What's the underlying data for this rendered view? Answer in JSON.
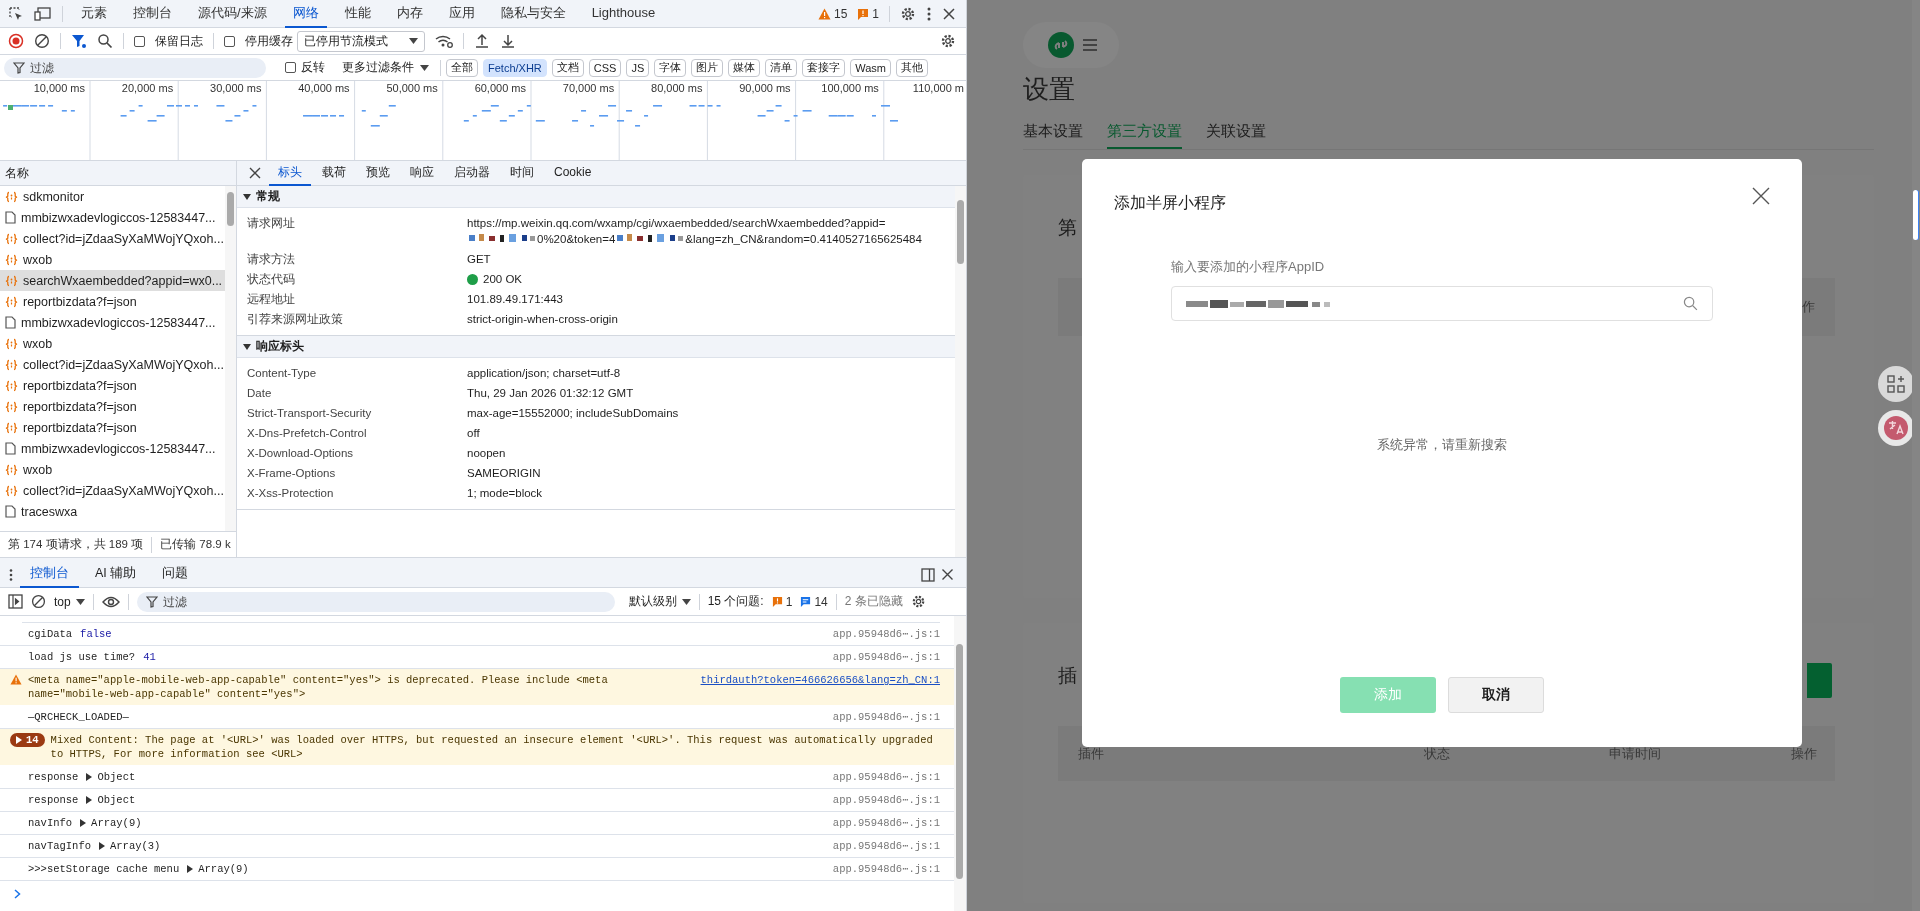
{
  "devtools": {
    "tabs": [
      {
        "label": "元素",
        "selected": false
      },
      {
        "label": "控制台",
        "selected": false
      },
      {
        "label": "源代码/来源",
        "selected": false
      },
      {
        "label": "网络",
        "selected": true
      },
      {
        "label": "性能",
        "selected": false
      },
      {
        "label": "内存",
        "selected": false
      },
      {
        "label": "应用",
        "selected": false
      },
      {
        "label": "隐私与安全",
        "selected": false
      },
      {
        "label": "Lighthouse",
        "selected": false
      }
    ],
    "warning_count": "15",
    "error_count": "1",
    "network_toolbar": {
      "preserve_log": {
        "label": "保留日志",
        "checked": false
      },
      "disable_cache": {
        "label": "停用缓存",
        "checked": false
      },
      "throttling": "已停用节流模式"
    },
    "filter_bar": {
      "placeholder": "过滤",
      "invert": {
        "label": "反转",
        "checked": false
      },
      "more_filters": "更多过滤条件",
      "types": [
        {
          "label": "全部",
          "selected": false
        },
        {
          "label": "Fetch/XHR",
          "selected": true
        },
        {
          "label": "文档",
          "selected": false
        },
        {
          "label": "CSS",
          "selected": false
        },
        {
          "label": "JS",
          "selected": false
        },
        {
          "label": "字体",
          "selected": false
        },
        {
          "label": "图片",
          "selected": false
        },
        {
          "label": "媒体",
          "selected": false
        },
        {
          "label": "清单",
          "selected": false
        },
        {
          "label": "套接字",
          "selected": false
        },
        {
          "label": "Wasm",
          "selected": false
        },
        {
          "label": "其他",
          "selected": false
        }
      ]
    },
    "timeline": {
      "ticks": [
        "10,000 ms",
        "20,000 ms",
        "30,000 ms",
        "40,000 ms",
        "50,000 ms",
        "60,000 ms",
        "70,000 ms",
        "80,000 ms",
        "90,000 ms",
        "100,000 ms",
        "110,000 m"
      ]
    },
    "requests": {
      "header": "名称",
      "rows": [
        {
          "name": "sdkmonitor",
          "kind": "xhr",
          "selected": false
        },
        {
          "name": "mmbizwxadevlogiccos-12583447...",
          "kind": "doc",
          "selected": false
        },
        {
          "name": "collect?id=jZdaaSyXaMWojYQxoh...",
          "kind": "xhr",
          "selected": false
        },
        {
          "name": "wxob",
          "kind": "xhr",
          "selected": false
        },
        {
          "name": "searchWxaembedded?appid=wx0...",
          "kind": "xhr",
          "selected": true
        },
        {
          "name": "reportbizdata?f=json",
          "kind": "xhr",
          "selected": false
        },
        {
          "name": "mmbizwxadevlogiccos-12583447...",
          "kind": "doc",
          "selected": false
        },
        {
          "name": "wxob",
          "kind": "xhr",
          "selected": false
        },
        {
          "name": "collect?id=jZdaaSyXaMWojYQxoh...",
          "kind": "xhr",
          "selected": false
        },
        {
          "name": "reportbizdata?f=json",
          "kind": "xhr",
          "selected": false
        },
        {
          "name": "reportbizdata?f=json",
          "kind": "xhr",
          "selected": false
        },
        {
          "name": "reportbizdata?f=json",
          "kind": "xhr",
          "selected": false
        },
        {
          "name": "mmbizwxadevlogiccos-12583447...",
          "kind": "doc",
          "selected": false
        },
        {
          "name": "wxob",
          "kind": "xhr",
          "selected": false
        },
        {
          "name": "collect?id=jZdaaSyXaMWojYQxoh...",
          "kind": "xhr",
          "selected": false
        },
        {
          "name": "traceswxa",
          "kind": "doc",
          "selected": false
        }
      ]
    },
    "status_bar": [
      "第 174 项请求，共 189 项",
      "已传输 78.9 k"
    ],
    "details": {
      "tabs": [
        {
          "label": "标头",
          "selected": true
        },
        {
          "label": "载荷",
          "selected": false
        },
        {
          "label": "预览",
          "selected": false
        },
        {
          "label": "响应",
          "selected": false
        },
        {
          "label": "启动器",
          "selected": false
        },
        {
          "label": "时间",
          "selected": false
        },
        {
          "label": "Cookie",
          "selected": false
        }
      ],
      "sections": [
        {
          "title": "常规",
          "expanded": true,
          "rows": [
            {
              "key": "请求网址",
              "kind": "url",
              "parts": [
                {
                  "kind": "text",
                  "text": "https://mp.weixin.qq.com/wxamp/cgi/wxaembedded/searchWxaembedded?appid"
                },
                {
                  "kind": "text",
                  "text": "="
                },
                {
                  "kind": "redacted"
                },
                {
                  "kind": "text",
                  "text": "0%20&token=4"
                },
                {
                  "kind": "redacted"
                },
                {
                  "kind": "text",
                  "text": "&lang=zh_CN&random=0.4140527165625484"
                }
              ]
            },
            {
              "key": "请求方法",
              "kind": "text",
              "value": "GET"
            },
            {
              "key": "状态代码",
              "kind": "status",
              "value": "200 OK",
              "color": "#1e9e48"
            },
            {
              "key": "远程地址",
              "kind": "text",
              "value": "101.89.49.171:443"
            },
            {
              "key": "引荐来源网址政策",
              "kind": "text",
              "value": "strict-origin-when-cross-origin"
            }
          ]
        },
        {
          "title": "响应标头",
          "expanded": true,
          "rows": [
            {
              "key": "Content-Type",
              "kind": "text",
              "value": "application/json; charset=utf-8"
            },
            {
              "key": "Date",
              "kind": "text",
              "value": "Thu, 29 Jan 2026 01:32:12 GMT"
            },
            {
              "key": "Strict-Transport-Security",
              "kind": "text",
              "value": "max-age=15552000; includeSubDomains"
            },
            {
              "key": "X-Dns-Prefetch-Control",
              "kind": "text",
              "value": "off"
            },
            {
              "key": "X-Download-Options",
              "kind": "text",
              "value": "noopen"
            },
            {
              "key": "X-Frame-Options",
              "kind": "text",
              "value": "SAMEORIGIN"
            },
            {
              "key": "X-Xss-Protection",
              "kind": "text",
              "value": "1; mode=block"
            }
          ]
        }
      ]
    },
    "console": {
      "tabs": [
        {
          "label": "控制台",
          "selected": true
        },
        {
          "label": "AI 辅助",
          "selected": false
        },
        {
          "label": "问题",
          "selected": false
        }
      ],
      "toolbar": {
        "context": "top",
        "placeholder": "过滤",
        "level": "默认级别",
        "issues_label": "15 个问题:",
        "issue_errors": "1",
        "issue_infos": "14",
        "hidden": "2 条已隐藏"
      },
      "messages": [
        {
          "kind": "log",
          "text": "cgiData",
          "value": "false",
          "expandable": false,
          "source": "app.95948d6⋯.js:1"
        },
        {
          "kind": "log",
          "text": "load js use time?",
          "value": "41",
          "expandable": false,
          "source": "app.95948d6⋯.js:1"
        },
        {
          "kind": "warning",
          "text": "<meta name=\"apple-mobile-web-app-capable\" content=\"yes\"> is deprecated. Please include <meta name=\"mobile-web-app-capable\" content=\"yes\">",
          "source": "thirdauth?token=466626656&lang=zh_CN:1"
        },
        {
          "kind": "log",
          "text": "—QRCHECK_LOADED—",
          "source": "app.95948d6⋯.js:1"
        },
        {
          "kind": "issue",
          "count": "14",
          "text": "Mixed Content: The page at '<URL>' was loaded over HTTPS, but requested an insecure element '<URL>'. This request was automatically upgraded to HTTPS, For more information see <URL>"
        },
        {
          "kind": "log",
          "text": "response",
          "value": "Object",
          "expandable": true,
          "source": "app.95948d6⋯.js:1"
        },
        {
          "kind": "log",
          "text": "response",
          "value": "Object",
          "expandable": true,
          "source": "app.95948d6⋯.js:1"
        },
        {
          "kind": "log",
          "text": "navInfo",
          "value": "Array(9)",
          "expandable": true,
          "source": "app.95948d6⋯.js:1"
        },
        {
          "kind": "log",
          "text": "navTagInfo",
          "value": "Array(3)",
          "expandable": true,
          "source": "app.95948d6⋯.js:1"
        },
        {
          "kind": "log",
          "text": ">>>setStorage cache menu",
          "value": "Array(9)",
          "expandable": true,
          "source": "app.95948d6⋯.js:1"
        }
      ]
    }
  },
  "page": {
    "title": "设置",
    "tabs": [
      {
        "label": "基本设置",
        "selected": false
      },
      {
        "label": "第三方设置",
        "selected": true
      },
      {
        "label": "关联设置",
        "selected": false
      }
    ],
    "card_1": {
      "title": "第",
      "header_tail": "作"
    },
    "card_2": {
      "title": "插",
      "columns": [
        "插件",
        "状态",
        "申请时间",
        "操作"
      ]
    },
    "dialog": {
      "title": "添加半屏小程序",
      "field_label": "输入要添加的小程序AppID",
      "message": "系统异常，请重新搜索",
      "buttons": [
        {
          "label": "添加",
          "kind": "primary",
          "disabled": true
        },
        {
          "label": "取消",
          "kind": "default",
          "disabled": false
        }
      ]
    }
  }
}
